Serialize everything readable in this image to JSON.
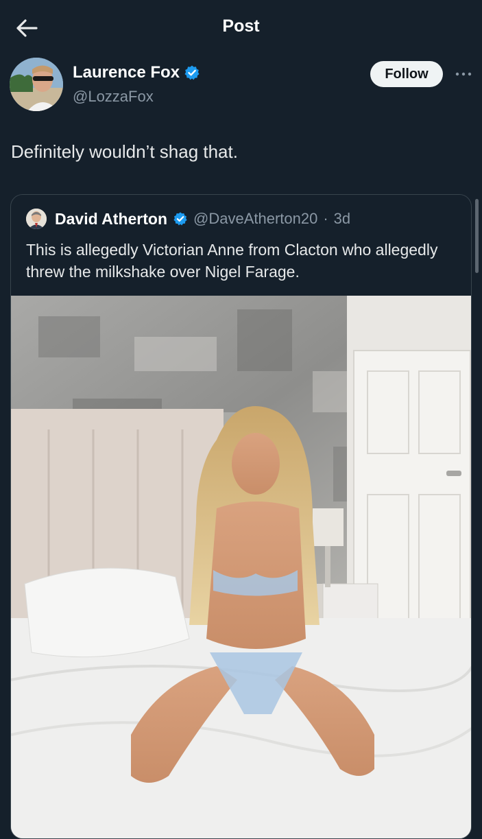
{
  "header": {
    "title": "Post"
  },
  "post": {
    "author_name": "Laurence Fox",
    "author_handle": "@LozzaFox",
    "follow_label": "Follow",
    "text": "Definitely wouldn’t shag that."
  },
  "quote": {
    "author_name": "David Atherton",
    "author_handle": "@DaveAtherton20",
    "separator": "·",
    "age": "3d",
    "text": "This is allegedly Victorian Anne from Clacton who allegedly threw the milkshake over Nigel Farage."
  },
  "icons": {
    "back": "arrow-left-icon",
    "verified": "verified-badge-icon",
    "more": "more-dots-icon"
  },
  "colors": {
    "background": "#15202b",
    "verified_blue": "#1d9bf0",
    "follow_bg": "#eff3f4",
    "muted_text": "#8b98a5",
    "border": "#38444d"
  }
}
